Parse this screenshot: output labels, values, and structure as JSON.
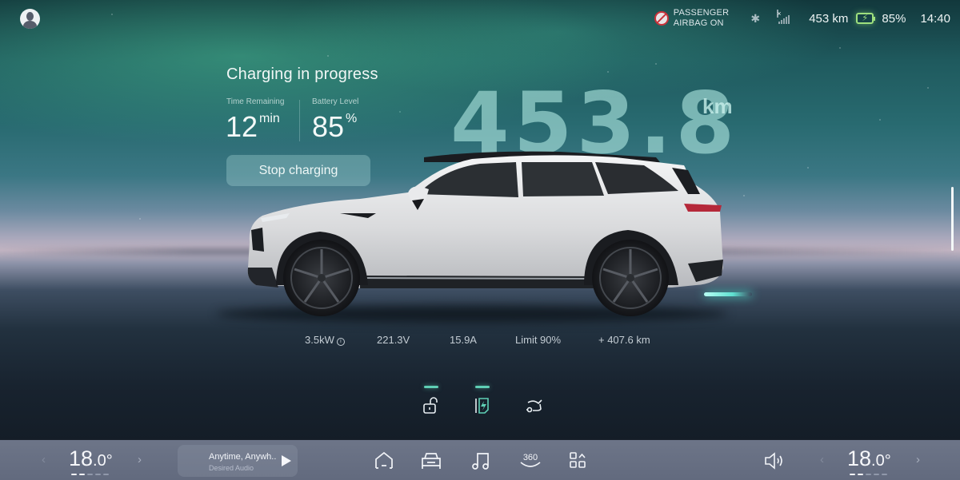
{
  "status_bar": {
    "airbag_line1": "PASSENGER",
    "airbag_line2": "AIRBAG ON",
    "bluetooth_icon": "bluetooth-icon",
    "signal_icon": "cellular-no-signal-icon",
    "range": "453 km",
    "battery_icon": "battery-charging-icon",
    "battery_percent": "85%",
    "time": "14:40"
  },
  "charging": {
    "title": "Charging in progress",
    "time_remaining_label": "Time Remaining",
    "time_remaining_value": "12",
    "time_remaining_unit": "min",
    "battery_level_label": "Battery Level",
    "battery_level_value": "85",
    "battery_level_unit": "%",
    "stop_button": "Stop charging",
    "range_big": "453.8",
    "range_unit": "km"
  },
  "stats": {
    "power": "3.5kW",
    "voltage": "221.3V",
    "current": "15.9A",
    "limit": "Limit 90%",
    "added_range": "+ 407.6 km"
  },
  "quick_actions": [
    {
      "name": "unlock",
      "icon": "unlock-icon",
      "active": true
    },
    {
      "name": "charge-port",
      "icon": "charge-port-icon",
      "active": true
    },
    {
      "name": "trunk",
      "icon": "trunk-open-icon",
      "active": false
    }
  ],
  "dock": {
    "left_temp_int": "18",
    "left_temp_dec": ".0°",
    "right_temp_int": "18",
    "right_temp_dec": ".0°",
    "temp_level": 2,
    "temp_levels_total": 5,
    "media_title": "Anytime, Anywh..",
    "media_subtitle": "Desired Audio",
    "nav_icons": [
      "home-icon",
      "car-icon",
      "music-icon",
      "360-camera-icon",
      "apps-icon"
    ],
    "label_360": "360",
    "volume_icon": "volume-icon"
  },
  "colors": {
    "accent_teal": "#5fcfb5",
    "battery_green": "#9ee07e",
    "airbag_red": "#c9323a"
  }
}
